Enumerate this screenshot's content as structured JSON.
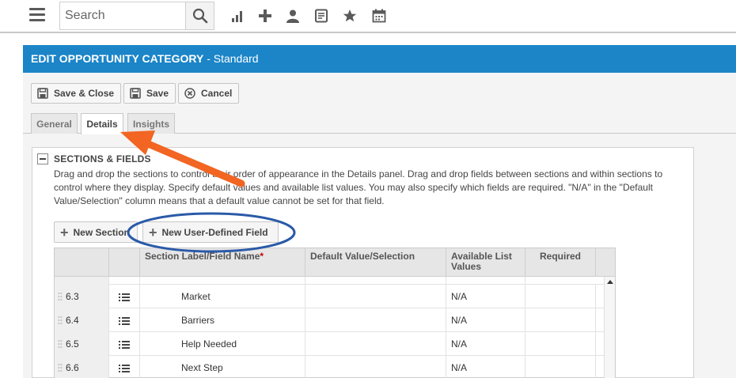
{
  "topbar": {
    "search_placeholder": "Search",
    "icons": [
      "menu-icon",
      "search-icon",
      "bar-chart-icon",
      "plus-icon",
      "person-icon",
      "form-icon",
      "star-icon",
      "calendar-icon"
    ]
  },
  "header": {
    "title": "EDIT OPPORTUNITY CATEGORY",
    "subtitle": "- Standard"
  },
  "toolbar": {
    "save_close_label": "Save & Close",
    "save_label": "Save",
    "cancel_label": "Cancel"
  },
  "tabs": [
    {
      "label": "General",
      "active": false
    },
    {
      "label": "Details",
      "active": true
    },
    {
      "label": "Insights",
      "active": false
    }
  ],
  "section": {
    "title": "SECTIONS & FIELDS",
    "description": "Drag and drop the sections to control their order of appearance in the Details panel. Drag and drop fields between sections and within sections to control where they display. Specify default values and available list values. You may also specify which fields are required. \"N/A\" in the \"Default Value/Selection\" column means that a default value cannot be set for that field.",
    "new_section_label": "New Section",
    "new_field_label": "New User-Defined Field"
  },
  "table": {
    "columns": [
      "",
      "",
      "Section Label/Field Name",
      "Default Value/Selection",
      "Available List Values",
      "Required"
    ],
    "required_marker": "*",
    "rows": [
      {
        "num": "6.3",
        "name": "Market",
        "default": "",
        "list": "N/A",
        "required": ""
      },
      {
        "num": "6.4",
        "name": "Barriers",
        "default": "",
        "list": "N/A",
        "required": ""
      },
      {
        "num": "6.5",
        "name": "Help Needed",
        "default": "",
        "list": "N/A",
        "required": ""
      },
      {
        "num": "6.6",
        "name": "Next Step",
        "default": "",
        "list": "N/A",
        "required": ""
      }
    ]
  },
  "colors": {
    "header_blue": "#1b85c8",
    "arrow_orange": "#f26522",
    "ellipse_blue": "#2a5aa8"
  }
}
